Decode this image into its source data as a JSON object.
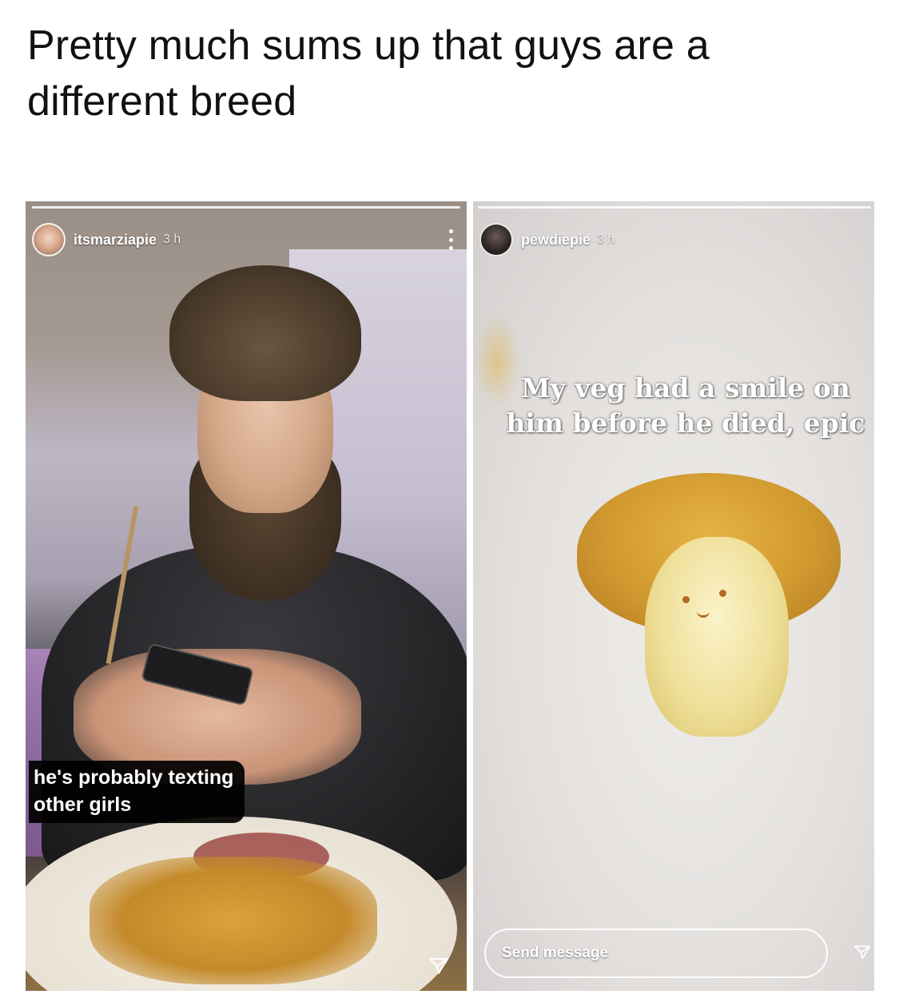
{
  "caption": {
    "line1": "Pretty much sums up that guys are a",
    "line2": "different breed"
  },
  "left_story": {
    "username": "itsmarziapie",
    "timestamp": "3 h",
    "overlay_text_line1": "he's probably texting",
    "overlay_text_line2": "other girls",
    "more_icon": "more-vertical-icon",
    "send_icon": "paper-plane-icon"
  },
  "right_story": {
    "username": "pewdiepie",
    "timestamp": "3 h",
    "overlay_text_line1": "My veg had a smile on",
    "overlay_text_line2": "him before he died, epic",
    "reply_placeholder": "Send message",
    "send_icon": "paper-plane-icon"
  },
  "colors": {
    "caption_text": "#111111",
    "story_text": "#ffffff",
    "caption_box": "#000000"
  }
}
